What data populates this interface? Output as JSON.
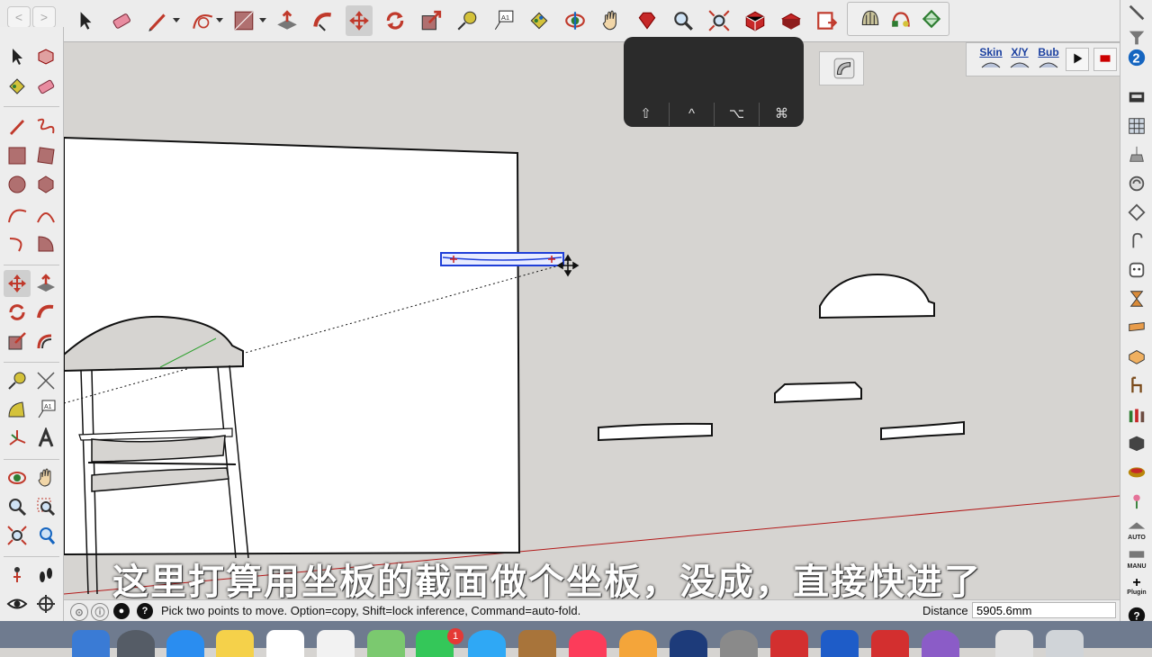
{
  "window": {
    "nav_back": "<",
    "nav_forward": ">"
  },
  "top_toolbar": {
    "tools": [
      "select-tool",
      "eraser-tool",
      "pencil-tool",
      "arc-tool",
      "rectangle-tool",
      "push-pull-tool",
      "follow-me-tool",
      "move-tool",
      "rotate-tool",
      "scale-tool",
      "tape-measure-tool",
      "text-tool",
      "paint-bucket-tool",
      "orbit-tool",
      "pan-tool",
      "ruby-extension",
      "zoom-tool",
      "zoom-extents-tool",
      "warehouse-tool",
      "extension-warehouse-tool",
      "send-to-layout-tool"
    ],
    "active_tool": "move-tool",
    "text_tool_label": "A1"
  },
  "extra_toolbar": {
    "tools": [
      "shell-tool",
      "joint-push-pull-tool",
      "bezier-tool"
    ]
  },
  "skin_toolbar": {
    "skin": "Skin",
    "xy": "X/Y",
    "bub": "Bub",
    "play": "play",
    "stop": "stop"
  },
  "small_panel": {
    "tool": "curviloft-tool"
  },
  "keypad": {
    "keys": [
      "⇧",
      "^",
      "⌥",
      "⌘"
    ]
  },
  "left_toolbar": {
    "text_label": "A1"
  },
  "right_toolbar": {
    "auto_label": "AUTO",
    "manu_label": "MANU",
    "plugin_label": "Plugin"
  },
  "subtitle": "这里打算用坐板的截面做个坐板，没成，直接快进了",
  "status": {
    "message": "Pick two points to move.  Option=copy, Shift=lock inference, Command=auto-fold.",
    "distance_label": "Distance",
    "distance_value": "5905.6mm"
  },
  "dock": {
    "mail_badge": "1"
  },
  "colors": {
    "accent_red": "#cc2222",
    "selection_blue": "#1f3fd8",
    "keypad_bg": "#2b2b2b"
  }
}
